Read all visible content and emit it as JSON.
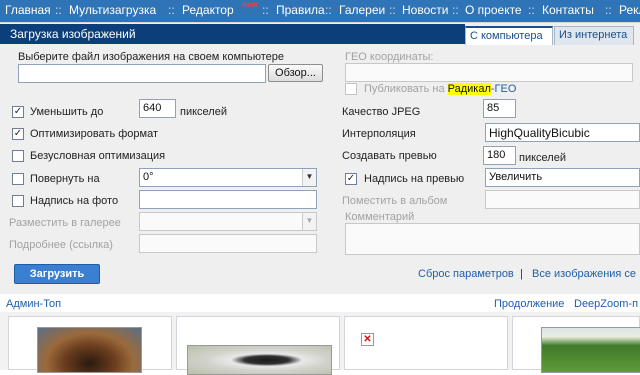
{
  "nav": {
    "items": [
      "Главная",
      "Мультизагрузка",
      "Редактор",
      "Правила",
      "Галереи",
      "Новости",
      "О проекте",
      "Контакты",
      "Рекла"
    ],
    "separator": "::",
    "new_badge": "new"
  },
  "panel": {
    "title": "Загрузка изображений",
    "tabs": [
      "С компьютера",
      "Из интернета"
    ]
  },
  "file": {
    "label": "Выберите файл изображения на своем компьютере",
    "value": "",
    "browse_label": "Обзор..."
  },
  "geo": {
    "label": "ГЕО координаты:",
    "value": "",
    "publish_prefix": "Публиковать на ",
    "publish_brand": "Радикал",
    "publish_suffix": "-ГЕО",
    "publish_checked": false
  },
  "left_options": {
    "reduce": {
      "label": "Уменьшить до",
      "checked": true,
      "value": "640",
      "unit": "пикселей"
    },
    "optimize": {
      "label": "Оптимизировать формат",
      "checked": true
    },
    "lossless": {
      "label": "Безусловная оптимизация",
      "checked": false
    },
    "rotate": {
      "label": "Повернуть на",
      "checked": false,
      "value": "0°"
    },
    "caption": {
      "label": "Надпись на фото",
      "checked": false,
      "value": ""
    },
    "gallery": {
      "label": "Разместить в галерее",
      "value": ""
    },
    "more": {
      "label": "Подробнее (ссылка)",
      "value": ""
    }
  },
  "right_options": {
    "quality": {
      "label": "Качество JPEG",
      "value": "85"
    },
    "interpolation": {
      "label": "Интерполяция",
      "value": "HighQualityBicubic"
    },
    "preview": {
      "label": "Создавать превью",
      "value": "180",
      "unit": "пикселей"
    },
    "preview_caption": {
      "label": "Надпись на превью",
      "checked": true,
      "value": "Увеличить"
    },
    "album": {
      "label": "Поместить в альбом",
      "value": ""
    },
    "comment": {
      "label": "Комментарий",
      "value": ""
    }
  },
  "actions": {
    "upload": "Загрузить",
    "reset": "Сброс параметров",
    "separator": "|",
    "all_images": "Все изображения се"
  },
  "bottom": {
    "admin_top": "Админ-Топ",
    "continue": "Продолжение",
    "deepzoom": "DeepZoom-п"
  },
  "icons": {
    "checkmark": "✓",
    "dropdown_arrow": "▼",
    "broken_image": "✕"
  },
  "colors": {
    "nav_bg": "#2f74b7",
    "title_bg": "#0c3f79",
    "brand_highlight": "#ffff00",
    "link": "#1f5fa8",
    "upload_button": "#3a7fd0"
  }
}
